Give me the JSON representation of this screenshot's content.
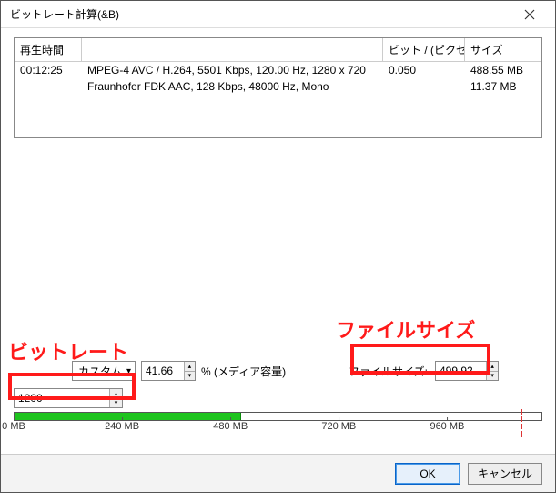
{
  "window": {
    "title": "ビットレート計算(&B)"
  },
  "grid": {
    "headers": {
      "duration": "再生時間",
      "desc": "",
      "bpp": "ビット / (ピクセル*...",
      "size": "サイズ"
    },
    "rows": [
      {
        "duration": "00:12:25",
        "desc": "MPEG-4 AVC / H.264, 5501 Kbps, 120.00 Hz, 1280 x 720",
        "bpp": "0.050",
        "size": "488.55 MB"
      },
      {
        "duration": "",
        "desc": "Fraunhofer FDK AAC, 128 Kbps, 48000 Hz, Mono",
        "bpp": "",
        "size": "11.37 MB"
      }
    ]
  },
  "controls": {
    "preset": "カスタム",
    "media_pct": "41.66",
    "media_pct_suffix": "% (メディア容量)",
    "bitrate": "1200",
    "filesize_label": "ファイルサイズ:",
    "filesize": "499.92"
  },
  "ruler": {
    "fill_pct": 43,
    "ticks": [
      {
        "label": "0 MB",
        "pos": 0
      },
      {
        "label": "240 MB",
        "pos": 20.5
      },
      {
        "label": "480 MB",
        "pos": 41
      },
      {
        "label": "720 MB",
        "pos": 61.5
      },
      {
        "label": "960 MB",
        "pos": 82
      }
    ],
    "limit_pos": 96
  },
  "buttons": {
    "ok": "OK",
    "cancel": "キャンセル"
  },
  "annotations": {
    "bitrate_label": "ビットレート",
    "filesize_label": "ファイルサイズ"
  }
}
